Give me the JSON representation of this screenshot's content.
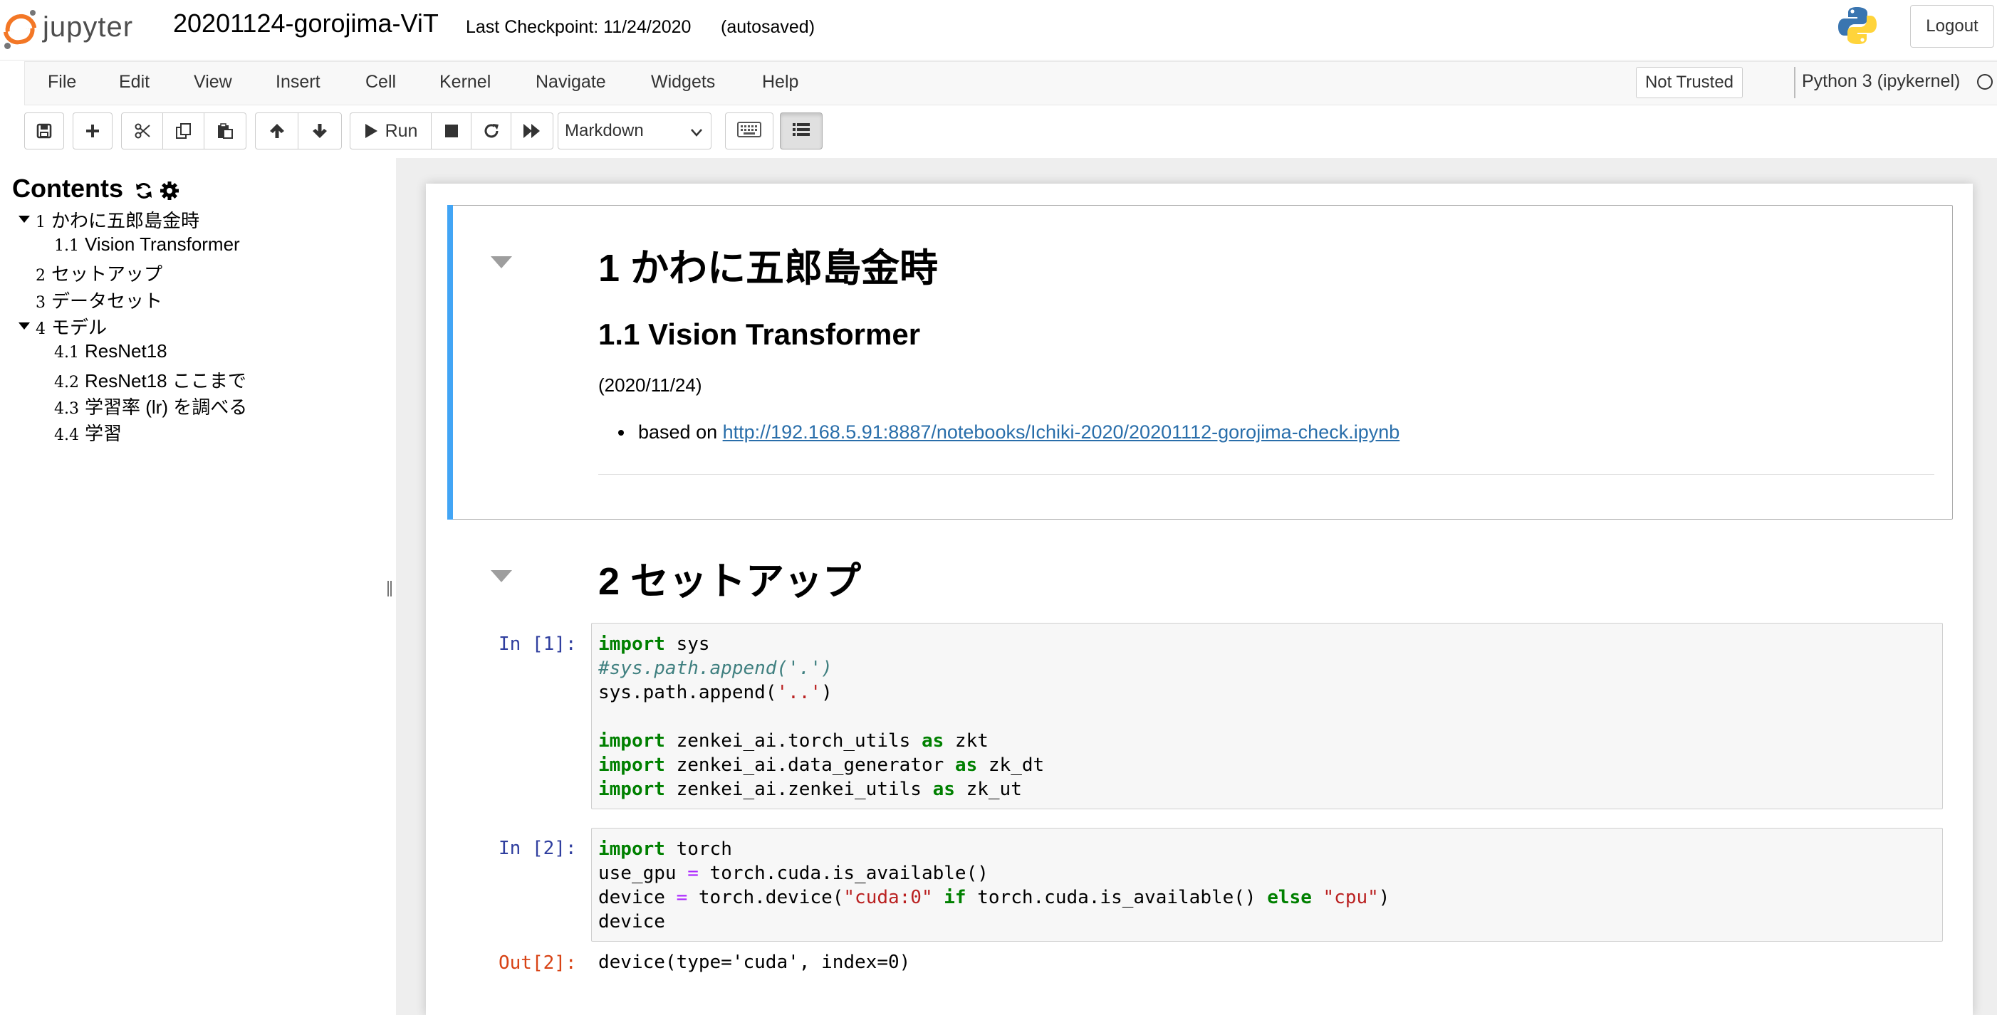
{
  "header": {
    "logo_text": "jupyter",
    "notebook_name": "20201124-gorojima-ViT",
    "checkpoint": "Last Checkpoint: 11/24/2020",
    "autosave": "(autosaved)",
    "logout_label": "Logout"
  },
  "menubar": {
    "items": [
      "File",
      "Edit",
      "View",
      "Insert",
      "Cell",
      "Kernel",
      "Navigate",
      "Widgets",
      "Help"
    ],
    "trust_label": "Not Trusted",
    "kernel_name": "Python 3 (ipykernel)"
  },
  "toolbar": {
    "run_label": "Run",
    "cell_type": "Markdown",
    "buttons": [
      "save-icon",
      "plus-icon",
      "cut-icon",
      "copy-icon",
      "paste-icon",
      "arrow-up-icon",
      "arrow-down-icon",
      "play-icon",
      "stop-icon",
      "refresh-icon",
      "fast-forward-icon",
      "keyboard-icon",
      "list-icon"
    ]
  },
  "toc": {
    "title": "Contents",
    "items": [
      {
        "num": "1",
        "label": "かわに五郎島金時"
      },
      {
        "num": "1.1",
        "label": "Vision Transformer"
      },
      {
        "num": "2",
        "label": "セットアップ"
      },
      {
        "num": "3",
        "label": "データセット"
      },
      {
        "num": "4",
        "label": "モデル"
      },
      {
        "num": "4.1",
        "label": "ResNet18"
      },
      {
        "num": "4.2",
        "label": "ResNet18 ここまで"
      },
      {
        "num": "4.3",
        "label": "学習率 (lr) を調べる"
      },
      {
        "num": "4.4",
        "label": "学習"
      }
    ]
  },
  "cells": {
    "md1": {
      "h1": "1  かわに五郎島金時",
      "h2": "1.1  Vision Transformer",
      "date": "(2020/11/24)",
      "based_prefix": "based on ",
      "based_link": "http://192.168.5.91:8887/notebooks/Ichiki-2020/20201112-gorojima-check.ipynb"
    },
    "md2": {
      "h1": "2  セットアップ"
    },
    "code1": {
      "prompt": "In [1]:",
      "lines": [
        {
          "kw": "import",
          "rest": " sys"
        },
        {
          "comment": "#sys.path.append('.')"
        },
        {
          "pre": "sys.path.append(",
          "str": "'..'",
          "post": ")"
        },
        {
          "blank": ""
        },
        {
          "kw": "import",
          "mid": " zenkei_ai.torch_utils ",
          "kw2": "as",
          "rest": " zkt"
        },
        {
          "kw": "import",
          "mid": " zenkei_ai.data_generator ",
          "kw2": "as",
          "rest": " zk_dt"
        },
        {
          "kw": "import",
          "mid": " zenkei_ai.zenkei_utils ",
          "kw2": "as",
          "rest": " zk_ut"
        }
      ]
    },
    "code2": {
      "prompt": "In [2]:",
      "out_prompt": "Out[2]:",
      "output": "device(type='cuda', index=0)"
    }
  },
  "colors": {
    "jupyter_orange": "#f37726",
    "selected_cell_bar": "#42a5f5",
    "link": "#296eaa",
    "prompt_in": "#303f9f",
    "prompt_out": "#d84315",
    "keyword": "#008000",
    "string": "#ba2121",
    "comment": "#408080",
    "operator": "#aa22ff"
  }
}
